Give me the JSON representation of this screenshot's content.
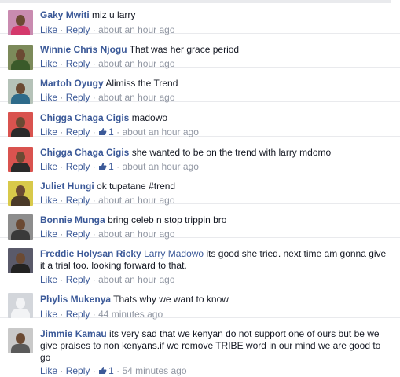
{
  "ui": {
    "like_label": "Like",
    "reply_label": "Reply",
    "separator": "·"
  },
  "colors": {
    "link": "#3b5998",
    "meta": "#9197a3",
    "text": "#141823",
    "divider": "#e9eaed"
  },
  "comments": [
    {
      "author": "Gaky Mwiti",
      "mention": "",
      "text": "miz u larry",
      "likes": "",
      "time": "about an hour ago",
      "avatar_bg": "#c98bb0",
      "avatar_shirt": "#d4386b"
    },
    {
      "author": "Winnie Chris Njogu",
      "mention": "",
      "text": "That was her grace period",
      "likes": "",
      "time": "about an hour ago",
      "avatar_bg": "#7c8a5a",
      "avatar_shirt": "#3a5a2a"
    },
    {
      "author": "Martoh Oyugy",
      "mention": "",
      "text": "Alimiss the Trend",
      "likes": "",
      "time": "about an hour ago",
      "avatar_bg": "#b5c2b8",
      "avatar_shirt": "#2e6b8a"
    },
    {
      "author": "Chigga Chaga Cigis",
      "mention": "",
      "text": "madowo",
      "likes": "1",
      "time": "about an hour ago",
      "avatar_bg": "#d9534f",
      "avatar_shirt": "#2a2a2a"
    },
    {
      "author": "Chigga Chaga Cigis",
      "mention": "",
      "text": "she wanted to be on the trend with larry mdomo",
      "likes": "1",
      "time": "about an hour ago",
      "avatar_bg": "#d9534f",
      "avatar_shirt": "#2a2a2a"
    },
    {
      "author": "Juliet Hungi",
      "mention": "",
      "text": "ok tupatane #trend",
      "likes": "",
      "time": "about an hour ago",
      "avatar_bg": "#d8c94a",
      "avatar_shirt": "#4a3a28"
    },
    {
      "author": "Bonnie Munga",
      "mention": "",
      "text": "bring celeb n stop trippin bro",
      "likes": "",
      "time": "about an hour ago",
      "avatar_bg": "#8d8d8d",
      "avatar_shirt": "#3a3a3a"
    },
    {
      "author": "Freddie Holysan Ricky",
      "mention": "Larry Madowo",
      "text": "its good she tried. next time am gonna give it a trial too. looking forward to that.",
      "likes": "",
      "time": "about an hour ago",
      "avatar_bg": "#5a5a6a",
      "avatar_shirt": "#222222"
    },
    {
      "author": "Phylis Mukenya",
      "mention": "",
      "text": "Thats why we want to know",
      "likes": "",
      "time": "44 minutes ago",
      "avatar_bg": "#d3d6db",
      "avatar_shirt": "#f2f3f5",
      "silhouette": true
    },
    {
      "author": "Jimmie Kamau",
      "mention": "",
      "text": "its very sad that we kenyan do not support one of ours but be we give praises to non kenyans.if we remove TRIBE word in our mind we are good to go",
      "likes": "1",
      "time": "54 minutes ago",
      "avatar_bg": "#c9c9c9",
      "avatar_shirt": "#5a5a5a"
    }
  ]
}
